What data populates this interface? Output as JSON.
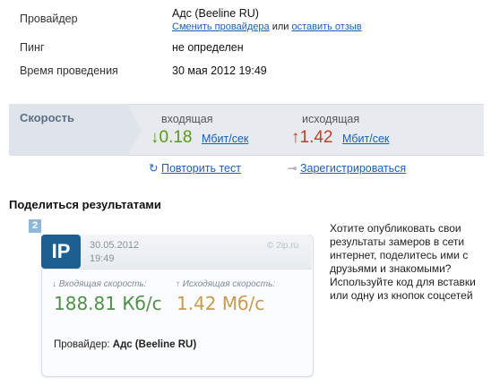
{
  "provider": {
    "label": "Провайдер",
    "value": "Адс (Beeline RU)",
    "change_link": "Сменить провайдера",
    "or": "или",
    "review_link": "оставить отзыв"
  },
  "ping": {
    "label": "Пинг",
    "value": "не определен"
  },
  "time": {
    "label": "Время проведения",
    "value": "30 мая 2012 19:49"
  },
  "speed": {
    "title": "Скорость",
    "incoming": {
      "label": "входящая",
      "arrow": "↓",
      "value": "0.18",
      "unit": "Мбит/сек"
    },
    "outgoing": {
      "label": "исходящая",
      "arrow": "↑",
      "value": "1.42",
      "unit": "Мбит/сек"
    }
  },
  "actions": {
    "retry": "Повторить тест",
    "register": "Зарегистрироваться"
  },
  "share": {
    "heading": "Поделиться результатами",
    "number": "2",
    "text_lines": [
      "Хотите опубликовать свои",
      "результаты замеров в сети",
      "интернет, поделитесь ими с",
      "друзьями и знакомыми?",
      "Используйте код для вставки",
      "или одну из кнопок соцсетей"
    ]
  },
  "card": {
    "logo": "IP",
    "date": "30.05.2012",
    "time": "19:49",
    "site": "© 2ip.ru",
    "in_label": "↓ Входящая скорость:",
    "out_label": "↑ Исходящая скорость:",
    "in_value": "188.81 Кб/с",
    "out_value": "1.42 Мб/с",
    "provider_label": "Провайдер:",
    "provider_value": "Адс (Beeline RU)"
  },
  "colors": {
    "green": "#5b9a15",
    "red": "#c63b2c",
    "link": "#1a5fb4",
    "card_blue": "#1c5f91"
  }
}
